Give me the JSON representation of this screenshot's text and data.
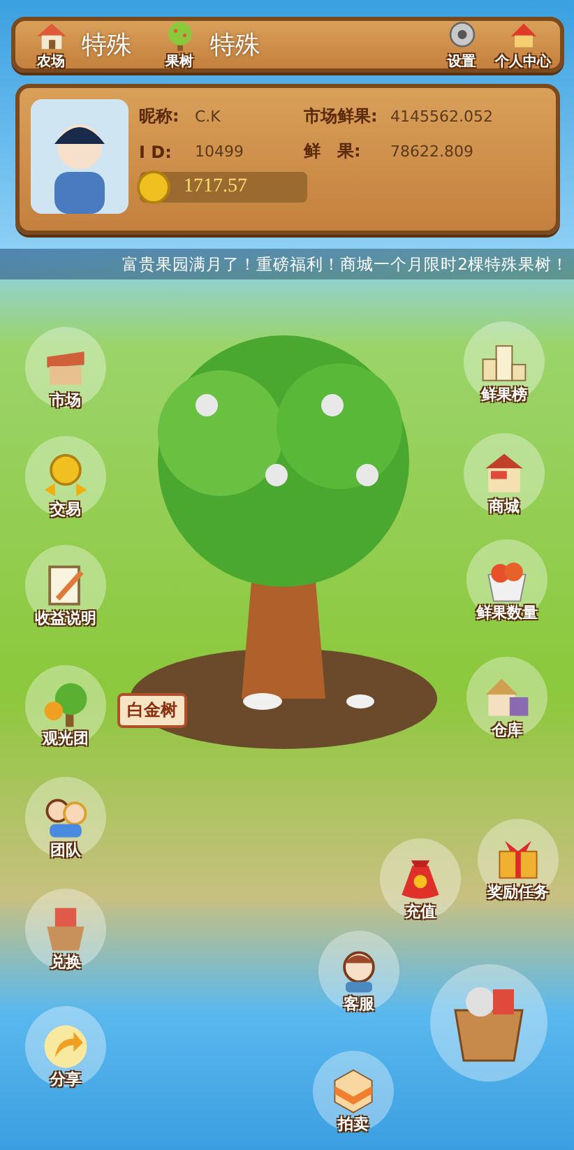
{
  "top_bar": {
    "stats": [
      {
        "kind": "farm",
        "label": "农场",
        "value": "特殊"
      },
      {
        "kind": "tree",
        "label": "果树",
        "value": "特殊"
      }
    ],
    "buttons": [
      {
        "kind": "settings",
        "label": "设置"
      },
      {
        "kind": "profile",
        "label": "个人中心"
      }
    ]
  },
  "profile": {
    "fields": [
      {
        "label": "昵称:",
        "value": "C.K"
      },
      {
        "label": "市场鲜果:",
        "value": "4145562.052"
      },
      {
        "label": "I D:",
        "value": "10499"
      },
      {
        "label": "鲜　果:",
        "value": "78622.809"
      }
    ],
    "coins": "1717.57"
  },
  "marquee": "富贵果园满月了！重磅福利！商城一个月限时2棵特殊果树！",
  "scene": {
    "sign": "白金树"
  },
  "left_menu": [
    {
      "kind": "market",
      "label": "市场"
    },
    {
      "kind": "trade",
      "label": "交易"
    },
    {
      "kind": "info",
      "label": "收益说明"
    },
    {
      "kind": "tour",
      "label": "观光团"
    },
    {
      "kind": "team",
      "label": "团队"
    },
    {
      "kind": "exchange",
      "label": "兑换"
    },
    {
      "kind": "share",
      "label": "分享"
    }
  ],
  "right_menu": [
    {
      "kind": "ranking",
      "label": "鲜果榜"
    },
    {
      "kind": "shop",
      "label": "商城"
    },
    {
      "kind": "fruit",
      "label": "鲜果数量"
    },
    {
      "kind": "warehouse",
      "label": "仓库"
    },
    {
      "kind": "reward",
      "label": "奖励任务"
    },
    {
      "kind": "recharge",
      "label": "充值"
    },
    {
      "kind": "service",
      "label": "客服"
    },
    {
      "kind": "auction",
      "label": "拍卖"
    },
    {
      "kind": "toolbox"
    }
  ]
}
